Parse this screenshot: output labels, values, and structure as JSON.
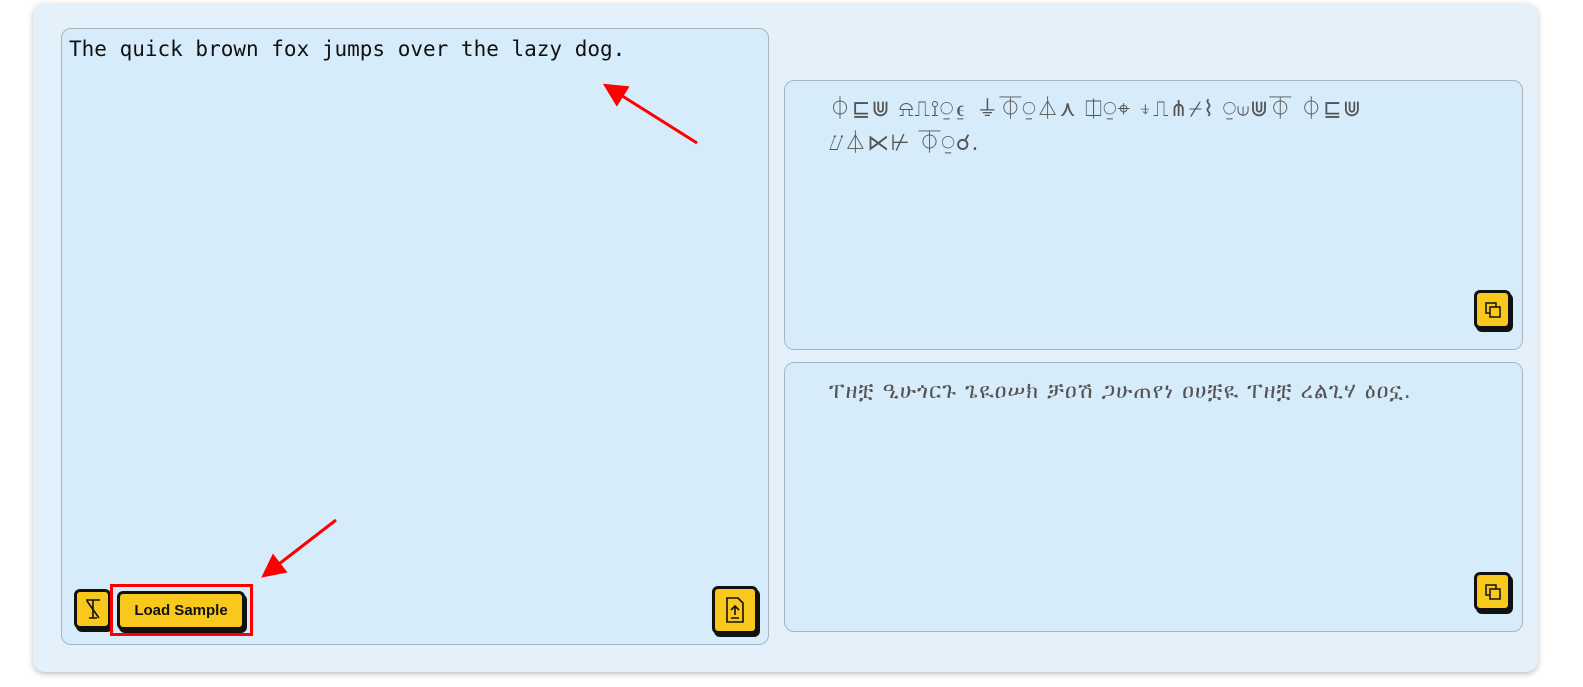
{
  "input": {
    "value": "The quick brown fox jumps over the lazy dog."
  },
  "outputs": [
    {
      "text": "⏀⊑⋓ ⍾⎍⟟⍜⍷ ⏚⏁⍜⏃⋏ ⎅⍜⌖ ⍖⎍⋔⌿⌇ ⍜⟒⋓⏁ ⏀⊑⋓ ⌰⏃⋉⊬ ⏁⍜☌."
    },
    {
      "text": "ፐዘቿ ዒሁጎርጉ ጌዪዐሠክ ቻዐሽ ጋሁጠየነ ዐሀቿዪ ፐዘቿ ረልጊሃ ዕዐኗ."
    }
  ],
  "buttons": {
    "clear_icon": "clear-format-icon",
    "load_sample": "Load Sample",
    "upload_icon": "file-upload-icon",
    "copy_icon": "copy-icon"
  },
  "colors": {
    "accent": "#f8c81c",
    "panel": "#d7ecfa",
    "annotation": "#ff0000"
  }
}
